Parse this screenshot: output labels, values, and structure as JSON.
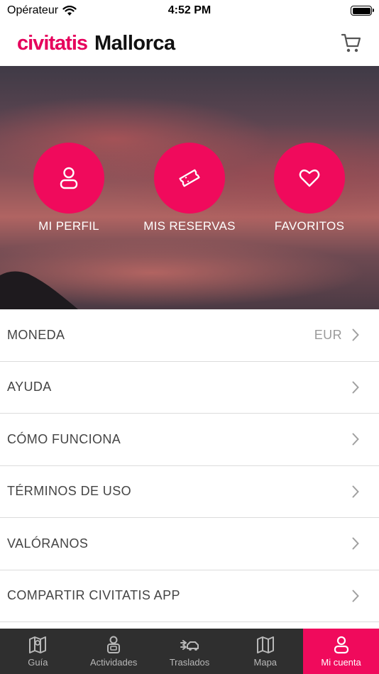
{
  "status_bar": {
    "carrier": "Opérateur",
    "time": "4:52 PM"
  },
  "header": {
    "brand": "civitatis",
    "city": "Mallorca"
  },
  "hero": {
    "actions": [
      {
        "label": "MI PERFIL",
        "icon": "user-icon"
      },
      {
        "label": "MIS RESERVAS",
        "icon": "ticket-icon"
      },
      {
        "label": "FAVORITOS",
        "icon": "heart-icon"
      }
    ]
  },
  "menu": {
    "items": [
      {
        "label": "MONEDA",
        "value": "EUR"
      },
      {
        "label": "AYUDA"
      },
      {
        "label": "CÓMO FUNCIONA"
      },
      {
        "label": "TÉRMINOS DE USO"
      },
      {
        "label": "VALÓRANOS"
      },
      {
        "label": "COMPARTIR CIVITATIS APP"
      }
    ]
  },
  "tabbar": {
    "tabs": [
      {
        "label": "Guía",
        "icon": "map-icon"
      },
      {
        "label": "Actividades",
        "icon": "guide-person-icon"
      },
      {
        "label": "Traslados",
        "icon": "transfer-car-icon"
      },
      {
        "label": "Mapa",
        "icon": "folded-map-icon"
      },
      {
        "label": "Mi cuenta",
        "icon": "user-icon"
      }
    ],
    "active_index": 4
  },
  "colors": {
    "brand": "#e6005c",
    "accent": "#f00a5c",
    "tabbar_bg": "#2f2f2f"
  }
}
